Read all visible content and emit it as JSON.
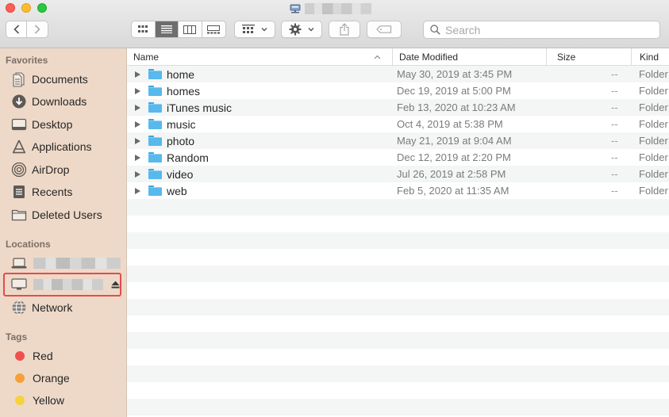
{
  "window": {
    "title_redacted": true
  },
  "toolbar": {
    "search_placeholder": "Search"
  },
  "sidebar": {
    "favorites_label": "Favorites",
    "favorites": [
      {
        "label": "Documents",
        "icon": "documents-icon"
      },
      {
        "label": "Downloads",
        "icon": "downloads-icon"
      },
      {
        "label": "Desktop",
        "icon": "desktop-icon"
      },
      {
        "label": "Applications",
        "icon": "applications-icon"
      },
      {
        "label": "AirDrop",
        "icon": "airdrop-icon"
      },
      {
        "label": "Recents",
        "icon": "recents-icon"
      },
      {
        "label": "Deleted Users",
        "icon": "folder-icon"
      }
    ],
    "locations_label": "Locations",
    "network_label": "Network",
    "tags_label": "Tags",
    "tags": [
      {
        "label": "Red",
        "color": "#f0504c"
      },
      {
        "label": "Orange",
        "color": "#f6a03a"
      },
      {
        "label": "Yellow",
        "color": "#f5d33b"
      }
    ]
  },
  "columns": {
    "name": "Name",
    "date": "Date Modified",
    "size": "Size",
    "kind": "Kind"
  },
  "rows": [
    {
      "name": "home",
      "date": "May 30, 2019 at 3:45 PM",
      "size": "--",
      "kind": "Folder"
    },
    {
      "name": "homes",
      "date": "Dec 19, 2019 at 5:00 PM",
      "size": "--",
      "kind": "Folder"
    },
    {
      "name": "iTunes music",
      "date": "Feb 13, 2020 at 10:23 AM",
      "size": "--",
      "kind": "Folder"
    },
    {
      "name": "music",
      "date": "Oct 4, 2019 at 5:38 PM",
      "size": "--",
      "kind": "Folder"
    },
    {
      "name": "photo",
      "date": "May 21, 2019 at 9:04 AM",
      "size": "--",
      "kind": "Folder"
    },
    {
      "name": "Random",
      "date": "Dec 12, 2019 at 2:20 PM",
      "size": "--",
      "kind": "Folder"
    },
    {
      "name": "video",
      "date": "Jul 26, 2019 at 2:58 PM",
      "size": "--",
      "kind": "Folder"
    },
    {
      "name": "web",
      "date": "Feb 5, 2020 at 11:35 AM",
      "size": "--",
      "kind": "Folder"
    }
  ]
}
